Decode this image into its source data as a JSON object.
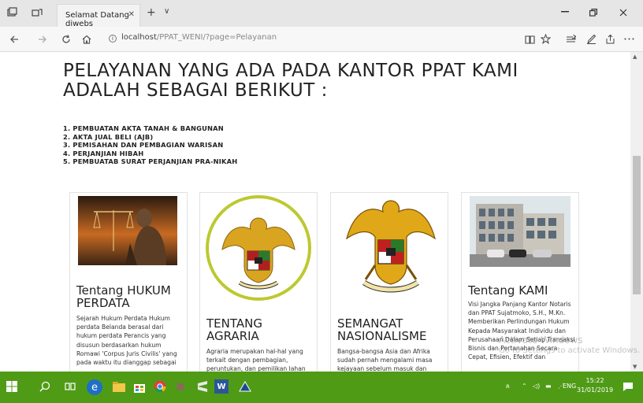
{
  "browser": {
    "tab_title": "Selamat Datang diwebs",
    "tab_close": "✕",
    "new_tab": "+",
    "tab_list": "∨",
    "url_host": "localhost",
    "url_path": "/PPAT_WENI/?page=Pelayanan"
  },
  "page": {
    "heading": "PELAYANAN YANG ADA PADA KANTOR PPAT KAMI ADALAH SEBAGAI BERIKUT :",
    "services": [
      "1. PEMBUATAN AKTA TANAH & BANGUNAN",
      "2. AKTA JUAL BELI (AJB)",
      "3. PEMISAHAN DAN PEMBAGIAN WARISAN",
      "4. PERJANJIAN HIBAH",
      "5. PEMBUATAB SURAT PERJANJIAN PRA-NIKAH"
    ],
    "cards": [
      {
        "title": "Tentang HUKUM PERDATA",
        "text": "Sejarah Hukum Perdata Hukum perdata Belanda berasal dari hukum perdata Perancis yang disusun berdasarkan hukum Romawi 'Corpus Juris Civilis' yang pada waktu itu dianggap sebagai"
      },
      {
        "title": "TENTANG AGRARIA",
        "text": "Agraria merupakan hal-hal yang terkait dengan pembagian, peruntukan, dan pemilikan lahan"
      },
      {
        "title": "SEMANGAT NASIONALISME",
        "text": "Bangsa-bangsa Asia dan Afrika sudah pernah mengalami masa kejayaan sebelum masuk dan"
      },
      {
        "title": "Tentang KAMI",
        "text": "Visi Jangka Panjang Kantor Notaris dan PPAT Sujatmoko, S.H., M.Kn. Memberikan Perlindungan Hukum Kepada Masyarakat Individu dan Perusahaan Dalam Setiap Transaksi Bisnis dan Pertanahan Secara Cepat, Efisien, Efektif dan"
      }
    ],
    "watermark_line1": "Activate Windows",
    "watermark_line2": "Go to Settings to activate Windows."
  },
  "taskbar": {
    "language": "ENG",
    "time": "15:22",
    "date": "31/01/2019"
  },
  "icons": {
    "back": "back-arrow-icon",
    "forward": "forward-arrow-icon",
    "refresh": "refresh-icon",
    "home": "home-icon",
    "reading_view": "reading-view-icon",
    "favorite": "star-icon",
    "hub": "hub-icon",
    "notes": "pen-icon",
    "share": "share-icon",
    "more": "more-icon"
  },
  "colors": {
    "taskbar": "#4f9b16",
    "circle_ring": "#bcc930",
    "emblem_gold": "#d9a520"
  }
}
